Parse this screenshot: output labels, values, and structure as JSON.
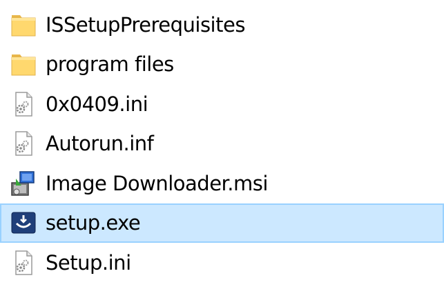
{
  "files": [
    {
      "name": "ISSetupPrerequisites",
      "icon": "folder-icon",
      "selected": false
    },
    {
      "name": "program files",
      "icon": "folder-icon",
      "selected": false
    },
    {
      "name": "0x0409.ini",
      "icon": "settings-file-icon",
      "selected": false
    },
    {
      "name": "Autorun.inf",
      "icon": "settings-file-icon",
      "selected": false
    },
    {
      "name": "Image Downloader.msi",
      "icon": "installer-package-icon",
      "selected": false
    },
    {
      "name": "setup.exe",
      "icon": "setup-app-icon",
      "selected": true
    },
    {
      "name": "Setup.ini",
      "icon": "settings-file-icon",
      "selected": false
    }
  ],
  "colors": {
    "selection_background": "#cce8ff",
    "selection_border": "#99d1ff",
    "folder": "#ffd86e"
  }
}
